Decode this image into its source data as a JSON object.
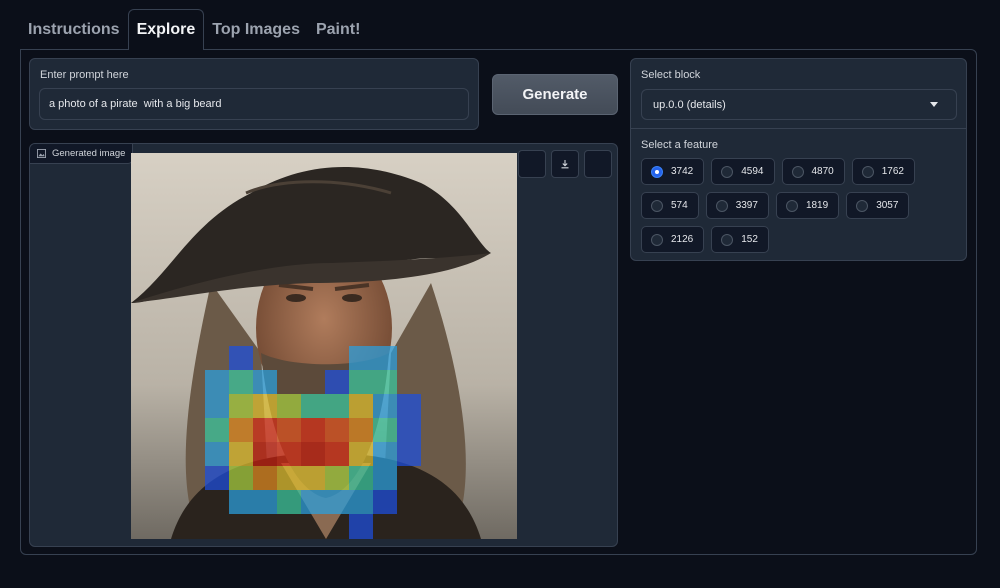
{
  "tabs": [
    {
      "label": "Instructions",
      "active": false
    },
    {
      "label": "Explore",
      "active": true
    },
    {
      "label": "Top Images",
      "active": false
    },
    {
      "label": "Paint!",
      "active": false
    }
  ],
  "prompt": {
    "label": "Enter prompt here",
    "value": "a photo of a pirate  with a big beard"
  },
  "generate_button": {
    "label": "Generate"
  },
  "image_panel": {
    "label": "Generated image",
    "tools": [
      "blank-tool",
      "download-icon",
      "blank-tool"
    ]
  },
  "block": {
    "label": "Select block",
    "selected": "up.0.0 (details)"
  },
  "features": {
    "label": "Select a feature",
    "selected": "3742",
    "rows": [
      [
        "3742",
        "4594",
        "4870",
        "1762"
      ],
      [
        "574",
        "3397",
        "1819",
        "3057"
      ],
      [
        "2126",
        "152"
      ]
    ]
  },
  "colors": {
    "background": "#0b0f19",
    "panel": "#1f2937",
    "border": "#374151",
    "accent": "#2563eb"
  }
}
